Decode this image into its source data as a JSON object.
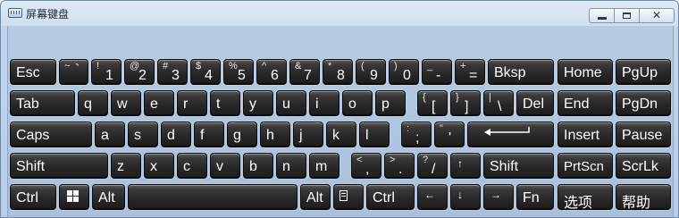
{
  "window": {
    "title": "屏幕键盘",
    "close_glyph": "✕"
  },
  "keys": {
    "esc": "Esc",
    "tilde_top": "~",
    "tilde_bot": "`",
    "k1_top": "!",
    "k1_bot": "1",
    "k2_top": "@",
    "k2_bot": "2",
    "k3_top": "#",
    "k3_bot": "3",
    "k4_top": "$",
    "k4_bot": "4",
    "k5_top": "%",
    "k5_bot": "5",
    "k6_top": "^",
    "k6_bot": "6",
    "k7_top": "&",
    "k7_bot": "7",
    "k8_top": "*",
    "k8_bot": "8",
    "k9_top": "(",
    "k9_bot": "9",
    "k0_top": ")",
    "k0_bot": "0",
    "minus_top": "_",
    "minus_bot": "-",
    "equal_top": "+",
    "equal_bot": "=",
    "bksp": "Bksp",
    "home": "Home",
    "pgup": "PgUp",
    "tab": "Tab",
    "q": "q",
    "w": "w",
    "e": "e",
    "r": "r",
    "t": "t",
    "y": "y",
    "u": "u",
    "i": "i",
    "o": "o",
    "p": "p",
    "lbracket_top": "{",
    "lbracket_bot": "[",
    "rbracket_top": "}",
    "rbracket_bot": "]",
    "backslash_top": "|",
    "backslash_bot": "\\",
    "del": "Del",
    "end": "End",
    "pgdn": "PgDn",
    "caps": "Caps",
    "a": "a",
    "s": "s",
    "d": "d",
    "f": "f",
    "g": "g",
    "h": "h",
    "j": "j",
    "k": "k",
    "l": "l",
    "semicolon_top": ":",
    "semicolon_bot": ";",
    "quote_top": "\"",
    "quote_bot": "'",
    "insert": "Insert",
    "pause": "Pause",
    "shift_left": "Shift",
    "z": "z",
    "x": "x",
    "c": "c",
    "v": "v",
    "b": "b",
    "n": "n",
    "m": "m",
    "comma_top": "<",
    "comma_bot": ",",
    "period_top": ">",
    "period_bot": ".",
    "slash_top": "?",
    "slash_bot": "/",
    "up_arrow": "↑",
    "shift_right": "Shift",
    "prtscn": "PrtScn",
    "scrlk": "ScrLk",
    "ctrl_left": "Ctrl",
    "alt_left": "Alt",
    "alt_right": "Alt",
    "ctrl_right": "Ctrl",
    "left_arrow": "←",
    "down_arrow": "↓",
    "right_arrow": "→",
    "fn": "Fn",
    "options": "选项",
    "help": "帮助"
  }
}
